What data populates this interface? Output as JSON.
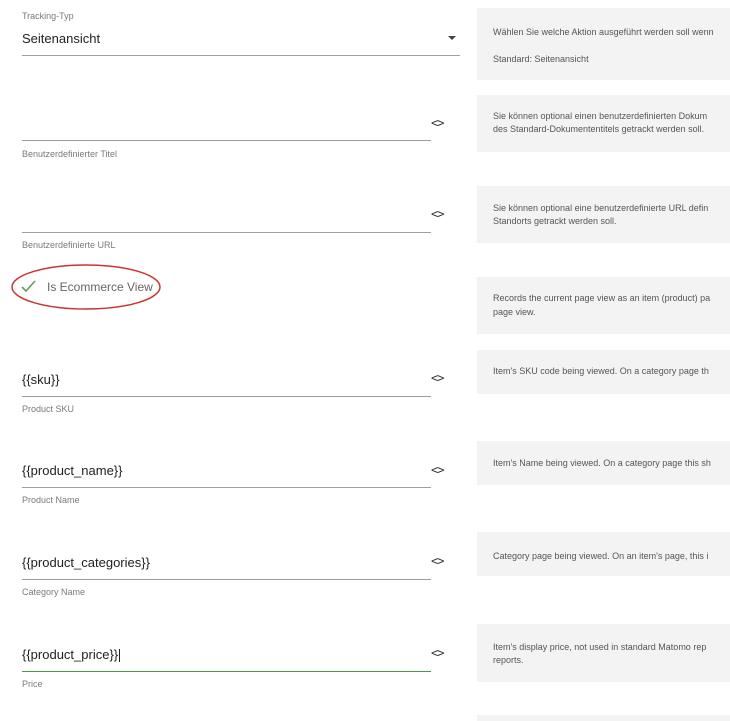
{
  "tracking_type": {
    "label": "Tracking-Typ",
    "value": "Seitenansicht",
    "help": "Wählen Sie welche Aktion ausgeführt werden soll wenn",
    "help_default": "Standard: Seitenansicht"
  },
  "custom_title": {
    "label": "Benutzerdefinierter Titel",
    "value": "",
    "help_line1": "Sie können optional einen benutzerdefinierten Dokum",
    "help_line2": "des Standard-Dokumententitels getrackt werden soll."
  },
  "custom_url": {
    "label": "Benutzerdefinierte URL",
    "value": "",
    "help_line1": "Sie können optional eine benutzerdefinierte URL defin",
    "help_line2": "Standorts getrackt werden soll."
  },
  "ecommerce_view": {
    "label": "Is Ecommerce View",
    "checked": true,
    "help_line1": "Records the current page view as an item (product) pa",
    "help_line2": "page view."
  },
  "product_sku": {
    "label": "Product SKU",
    "value": "{{sku}}",
    "help_line1": "Item's SKU code being viewed. On a category page th"
  },
  "product_name": {
    "label": "Product Name",
    "value": "{{product_name}}",
    "help_line1": "Item's Name being viewed. On a category page this sh"
  },
  "category_name": {
    "label": "Category Name",
    "value": "{{product_categories}}",
    "help_line1": "Category page being viewed. On an item's page, this i"
  },
  "price": {
    "label": "Price",
    "value": "{{product_price}}",
    "help_line1": "Item's display price, not used in standard Matomo rep",
    "help_line2": "reports."
  },
  "variable_icon": "<>",
  "colors": {
    "highlight_ellipse": "#cc3333",
    "checkmark": "#5aa05a",
    "active_underline": "#4a9a4a",
    "help_bg": "#f3f3f3"
  }
}
